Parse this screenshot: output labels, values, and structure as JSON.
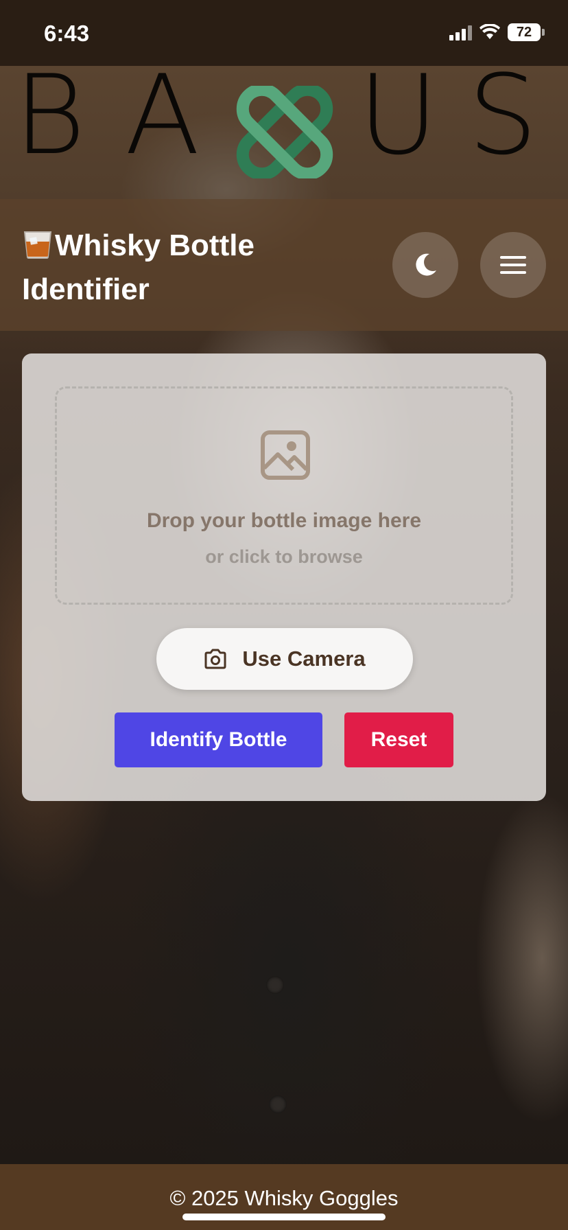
{
  "status_bar": {
    "time": "6:43",
    "battery": "72"
  },
  "logo": {
    "letters": [
      "B",
      "A",
      "U",
      "S"
    ],
    "accent_color": "#3d9a6a"
  },
  "header": {
    "title": "Whisky Bottle Identifier",
    "icons": {
      "title_icon": "whisky-glass-icon",
      "theme_toggle": "moon-icon",
      "menu": "hamburger-menu-icon"
    }
  },
  "upload": {
    "drop_title": "Drop your bottle image here",
    "drop_subtitle": "or click to browse",
    "camera_label": "Use Camera",
    "identify_label": "Identify Bottle",
    "reset_label": "Reset"
  },
  "colors": {
    "identify": "#4f46e5",
    "reset": "#e11d48",
    "header": "#5c422c",
    "footer": "#553a22"
  },
  "footer": {
    "text": "© 2025 Whisky Goggles"
  }
}
